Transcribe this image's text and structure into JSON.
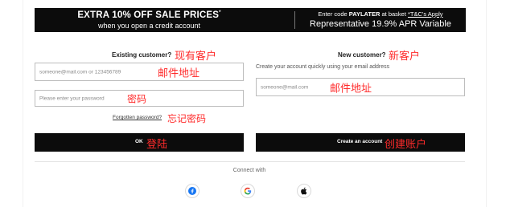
{
  "promo": {
    "title": "EXTRA 10% OFF SALE PRICES",
    "title_mark": "*",
    "subtitle": "when you open a credit account",
    "code_prefix": "Enter code ",
    "code": "PAYLATER",
    "code_suffix": " at basket ",
    "tc_link": "*T&C's Apply",
    "apr": "Representative 19.9% APR Variable"
  },
  "existing": {
    "heading": "Existing customer?",
    "heading_zh": "现有客户",
    "email_placeholder": "someone@mail.com or 123456789",
    "email_zh": "邮件地址",
    "password_placeholder": "Please enter your password",
    "password_zh": "密码",
    "forgot_label": "Forgotten password?",
    "forgot_zh": "忘记密码",
    "ok_label": "OK",
    "ok_zh": "登陆"
  },
  "new_customer": {
    "heading": "New customer?",
    "heading_zh": "新客户",
    "helper": "Create your account quickly using your email address",
    "email_placeholder": "someone@mail.com",
    "email_zh": "邮件地址",
    "create_label": "Create an account",
    "create_zh": "创建账户"
  },
  "connect": {
    "label": "Connect with",
    "providers": [
      "facebook-icon",
      "google-icon",
      "apple-icon"
    ]
  },
  "colors": {
    "annotation": "#ff2b2b",
    "primary": "#0c0c0c",
    "facebook": "#1877f2"
  }
}
